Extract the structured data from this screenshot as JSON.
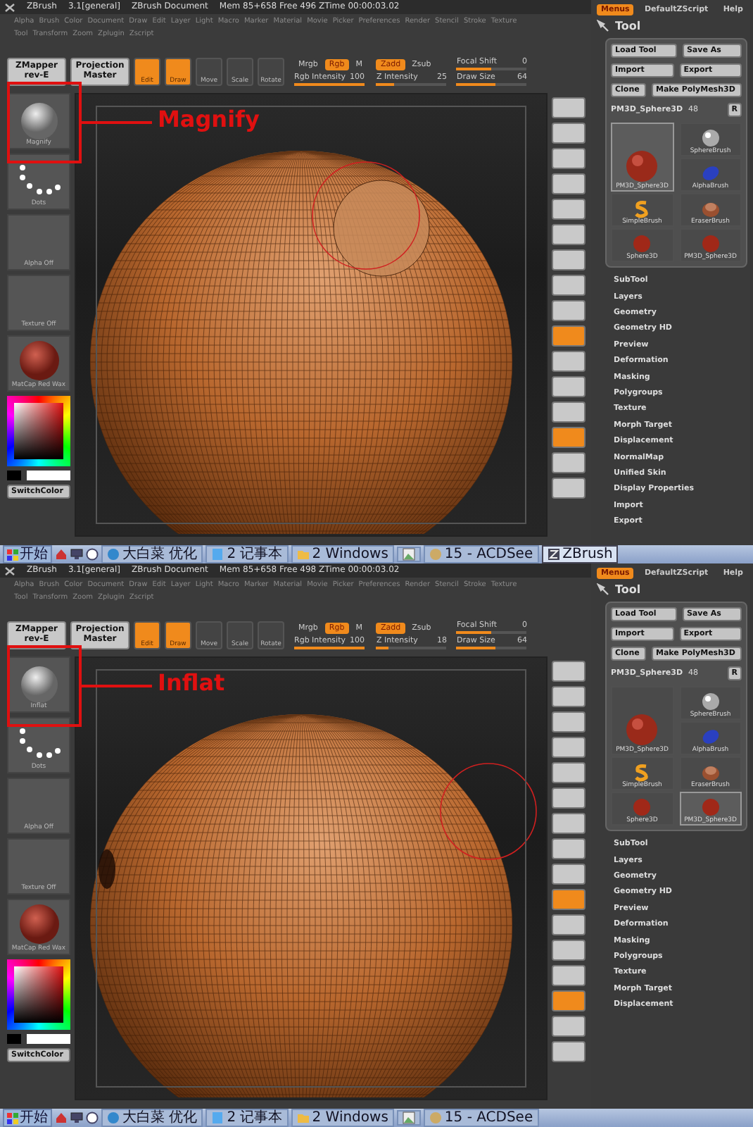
{
  "screens": [
    {
      "title_bar": {
        "app": "ZBrush",
        "version": "3.1[general]",
        "document": "ZBrush Document",
        "memory": "Mem 85+658 Free 496 ZTime 00:00:03.02",
        "buttons": [
          {
            "label": "Menus",
            "on": true
          },
          {
            "label": "DefaultZScript",
            "on": false
          },
          {
            "label": "Help",
            "on": false
          }
        ]
      },
      "menus": [
        [
          "Alpha",
          "Brush",
          "Color",
          "Document",
          "Draw",
          "Edit",
          "Layer",
          "Light",
          "Macro",
          "Marker",
          "Material",
          "Movie",
          "Picker",
          "Preferences",
          "Render",
          "Stencil",
          "Stroke",
          "Texture"
        ],
        [
          "Tool",
          "Transform",
          "Zoom",
          "Zplugin",
          "Zscript"
        ]
      ],
      "toolbar": {
        "big_buttons": [
          "ZMapper rev-E",
          "Projection Master"
        ],
        "modes": [
          {
            "label": "Edit",
            "on": true
          },
          {
            "label": "Draw",
            "on": true
          },
          {
            "label": "Move",
            "on": false
          },
          {
            "label": "Scale",
            "on": false
          },
          {
            "label": "Rotate",
            "on": false
          }
        ],
        "groups": [
          {
            "toggles": [
              {
                "label": "Mrgb",
                "on": false
              },
              {
                "label": "Rgb",
                "on": true
              },
              {
                "label": "M",
                "on": false
              }
            ],
            "sliders": [
              {
                "label": "Rgb Intensity",
                "value": "100",
                "level": 1
              }
            ]
          },
          {
            "toggles": [
              {
                "label": "Zadd",
                "on": true
              },
              {
                "label": "Zsub",
                "on": false
              }
            ],
            "sliders": [
              {
                "label": "Z Intensity",
                "value": "25",
                "level": 0.25
              }
            ]
          },
          {
            "sliders": [
              {
                "label": "Focal Shift",
                "value": "0",
                "level": 0.5
              },
              {
                "label": "Draw Size",
                "value": "64",
                "level": 0.55
              }
            ]
          }
        ]
      },
      "left_shelf": [
        {
          "kind": "brush",
          "label": "Magnify"
        },
        {
          "kind": "stroke",
          "label": "Dots"
        },
        {
          "kind": "empty",
          "label": "Alpha Off"
        },
        {
          "kind": "empty",
          "label": "Texture Off"
        },
        {
          "kind": "material",
          "label": "MatCap Red Wax"
        },
        {
          "kind": "color",
          "label": "SwitchColor"
        }
      ],
      "canvas": {
        "bump": true
      },
      "right_shelf": [
        {
          "on": false
        },
        {
          "on": false
        },
        {
          "on": false
        },
        {
          "on": false
        },
        {
          "on": false
        },
        {
          "on": false
        },
        {
          "on": false
        },
        {
          "on": false
        },
        {
          "on": false
        },
        {
          "on": true
        },
        {
          "on": false
        },
        {
          "on": false
        },
        {
          "on": false
        },
        {
          "on": true
        },
        {
          "on": false
        },
        {
          "on": false
        }
      ],
      "annotation": {
        "label": "Magnify"
      },
      "tool_panel": {
        "title": "Tool",
        "buttons": [
          [
            "Load Tool",
            "Save As"
          ],
          [
            "Import",
            "Export"
          ],
          [
            "Clone",
            "Make PolyMesh3D"
          ]
        ],
        "current": "PM3D_Sphere3D",
        "count": "48",
        "r_button": "R",
        "thumbnail_columns": [
          [
            {
              "label": "PM3D_Sphere3D",
              "kind": "big-sphere",
              "selected": true
            },
            {
              "label": "SimpleBrush",
              "kind": "s-shape",
              "selected": false
            },
            {
              "label": "Sphere3D",
              "kind": "small-sphere",
              "selected": false
            }
          ],
          [
            {
              "label": "SphereBrush",
              "kind": "gray-ball",
              "selected": false
            },
            {
              "label": "AlphaBrush",
              "kind": "blue-blob",
              "selected": false
            },
            {
              "label": "EraserBrush",
              "kind": "eraser",
              "selected": false
            },
            {
              "label": "PM3D_Sphere3D",
              "kind": "small-sphere",
              "selected": false
            }
          ]
        ],
        "sections": [
          "SubTool",
          "Layers",
          "Geometry",
          "Geometry HD",
          "Preview",
          "Deformation",
          "Masking",
          "Polygroups",
          "Texture",
          "Morph Target",
          "Displacement",
          "NormalMap",
          "Unified Skin",
          "Display Properties",
          "Import",
          "Export"
        ]
      },
      "taskbar": {
        "start": "开始",
        "tasks": [
          {
            "label": "大白菜 优化",
            "kind": "globe",
            "selected": false
          },
          {
            "label": "2 记事本",
            "kind": "notepad",
            "selected": false
          },
          {
            "label": "2 Windows",
            "kind": "folder",
            "selected": false
          },
          {
            "kind": "picture",
            "selected": false
          },
          {
            "label": "15 - ACDSee",
            "kind": "disc",
            "selected": false
          },
          {
            "label": "ZBrush",
            "kind": "app",
            "selected": true
          }
        ]
      }
    },
    {
      "title_bar": {
        "app": "ZBrush",
        "version": "3.1[general]",
        "document": "ZBrush Document",
        "memory": "Mem 85+658 Free 498 ZTime 00:00:03.02",
        "buttons": [
          {
            "label": "Menus",
            "on": true
          },
          {
            "label": "DefaultZScript",
            "on": false
          },
          {
            "label": "Help",
            "on": false
          }
        ]
      },
      "menus": [
        [
          "Alpha",
          "Brush",
          "Color",
          "Document",
          "Draw",
          "Edit",
          "Layer",
          "Light",
          "Macro",
          "Marker",
          "Material",
          "Movie",
          "Picker",
          "Preferences",
          "Render",
          "Stencil",
          "Stroke",
          "Texture"
        ],
        [
          "Tool",
          "Transform",
          "Zoom",
          "Zplugin",
          "Zscript"
        ]
      ],
      "toolbar": {
        "big_buttons": [
          "ZMapper rev-E",
          "Projection Master"
        ],
        "modes": [
          {
            "label": "Edit",
            "on": true
          },
          {
            "label": "Draw",
            "on": true
          },
          {
            "label": "Move",
            "on": false
          },
          {
            "label": "Scale",
            "on": false
          },
          {
            "label": "Rotate",
            "on": false
          }
        ],
        "groups": [
          {
            "toggles": [
              {
                "label": "Mrgb",
                "on": false
              },
              {
                "label": "Rgb",
                "on": true
              },
              {
                "label": "M",
                "on": false
              }
            ],
            "sliders": [
              {
                "label": "Rgb Intensity",
                "value": "100",
                "level": 1
              }
            ]
          },
          {
            "toggles": [
              {
                "label": "Zadd",
                "on": true
              },
              {
                "label": "Zsub",
                "on": false
              }
            ],
            "sliders": [
              {
                "label": "Z Intensity",
                "value": "18",
                "level": 0.18
              }
            ]
          },
          {
            "sliders": [
              {
                "label": "Focal Shift",
                "value": "0",
                "level": 0.5
              },
              {
                "label": "Draw Size",
                "value": "64",
                "level": 0.55
              }
            ]
          }
        ]
      },
      "left_shelf": [
        {
          "kind": "brush",
          "label": "Inflat"
        },
        {
          "kind": "stroke",
          "label": "Dots"
        },
        {
          "kind": "empty",
          "label": "Alpha Off"
        },
        {
          "kind": "empty",
          "label": "Texture Off"
        },
        {
          "kind": "material",
          "label": "MatCap Red Wax"
        },
        {
          "kind": "color",
          "label": "SwitchColor"
        }
      ],
      "canvas": {
        "bump": false
      },
      "right_shelf": [
        {
          "on": false
        },
        {
          "on": false
        },
        {
          "on": false
        },
        {
          "on": false
        },
        {
          "on": false
        },
        {
          "on": false
        },
        {
          "on": false
        },
        {
          "on": false
        },
        {
          "on": false
        },
        {
          "on": true
        },
        {
          "on": false
        },
        {
          "on": false
        },
        {
          "on": false
        },
        {
          "on": true
        },
        {
          "on": false
        },
        {
          "on": false
        }
      ],
      "annotation": {
        "label": "Inflat"
      },
      "tool_panel": {
        "title": "Tool",
        "buttons": [
          [
            "Load Tool",
            "Save As"
          ],
          [
            "Import",
            "Export"
          ],
          [
            "Clone",
            "Make PolyMesh3D"
          ]
        ],
        "current": "PM3D_Sphere3D",
        "count": "48",
        "r_button": "R",
        "thumbnail_columns": [
          [
            {
              "label": "PM3D_Sphere3D",
              "kind": "big-sphere",
              "selected": false
            },
            {
              "label": "SimpleBrush",
              "kind": "s-shape",
              "selected": false
            },
            {
              "label": "Sphere3D",
              "kind": "small-sphere",
              "selected": false
            }
          ],
          [
            {
              "label": "SphereBrush",
              "kind": "gray-ball",
              "selected": false
            },
            {
              "label": "AlphaBrush",
              "kind": "blue-blob",
              "selected": false
            },
            {
              "label": "EraserBrush",
              "kind": "eraser",
              "selected": false
            },
            {
              "label": "PM3D_Sphere3D",
              "kind": "small-sphere",
              "selected": true
            }
          ]
        ],
        "sections": [
          "SubTool",
          "Layers",
          "Geometry",
          "Geometry HD",
          "Preview",
          "Deformation",
          "Masking",
          "Polygroups",
          "Texture",
          "Morph Target",
          "Displacement"
        ]
      },
      "taskbar": {
        "start": "开始",
        "tasks": [
          {
            "label": "大白菜 优化",
            "kind": "globe",
            "selected": false
          },
          {
            "label": "2 记事本",
            "kind": "notepad",
            "selected": false
          },
          {
            "label": "2 Windows",
            "kind": "folder",
            "selected": false
          },
          {
            "kind": "picture",
            "selected": false
          },
          {
            "label": "15 - ACDSee",
            "kind": "disc",
            "selected": false
          }
        ]
      }
    }
  ]
}
